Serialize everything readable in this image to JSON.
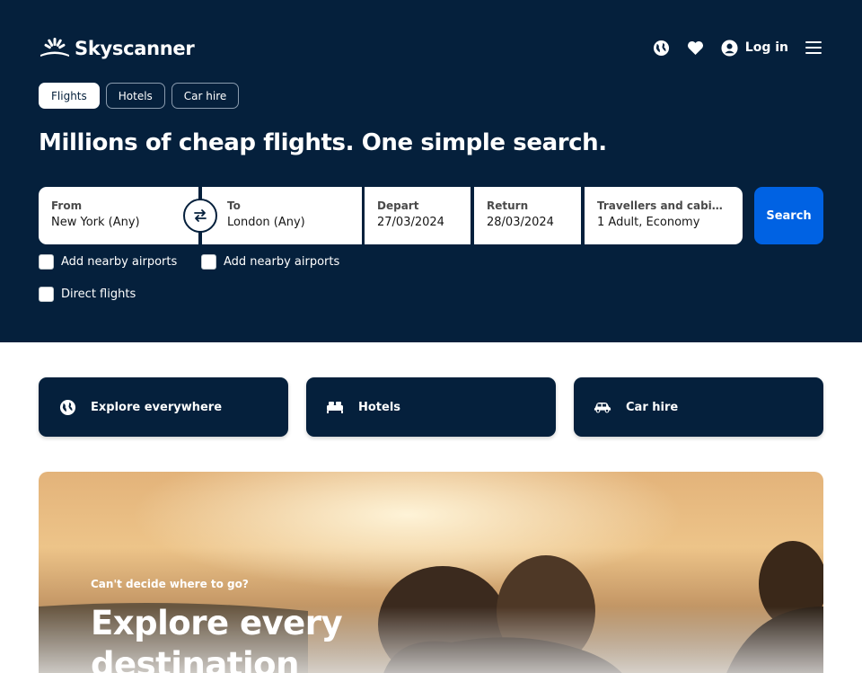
{
  "brand": {
    "name": "Skyscanner"
  },
  "header": {
    "login_label": "Log in",
    "icons": [
      "globe-icon",
      "heart-icon",
      "account-icon",
      "menu-icon"
    ]
  },
  "tabs": [
    {
      "label": "Flights",
      "active": true
    },
    {
      "label": "Hotels",
      "active": false
    },
    {
      "label": "Car hire",
      "active": false
    }
  ],
  "headline": "Millions of cheap flights. One simple search.",
  "search_form": {
    "from": {
      "label": "From",
      "value": "New York (Any)"
    },
    "to": {
      "label": "To",
      "value": "London (Any)"
    },
    "depart": {
      "label": "Depart",
      "value": "27/03/2024"
    },
    "return": {
      "label": "Return",
      "value": "28/03/2024"
    },
    "travellers": {
      "label": "Travellers and cabin cla...",
      "value": "1 Adult, Economy"
    },
    "search_label": "Search"
  },
  "checkboxes": [
    {
      "label": "Add nearby airports",
      "checked": false
    },
    {
      "label": "Add nearby airports",
      "checked": false
    },
    {
      "label": "Direct flights",
      "checked": false
    }
  ],
  "quick_links": [
    {
      "label": "Explore everywhere",
      "icon": "globe-icon"
    },
    {
      "label": "Hotels",
      "icon": "bed-icon"
    },
    {
      "label": "Car hire",
      "icon": "car-icon"
    }
  ],
  "promo": {
    "kicker": "Can't decide where to go?",
    "title": "Explore every destination"
  },
  "colors": {
    "navy": "#05203c",
    "accent_blue": "#0062e3",
    "white": "#ffffff"
  }
}
